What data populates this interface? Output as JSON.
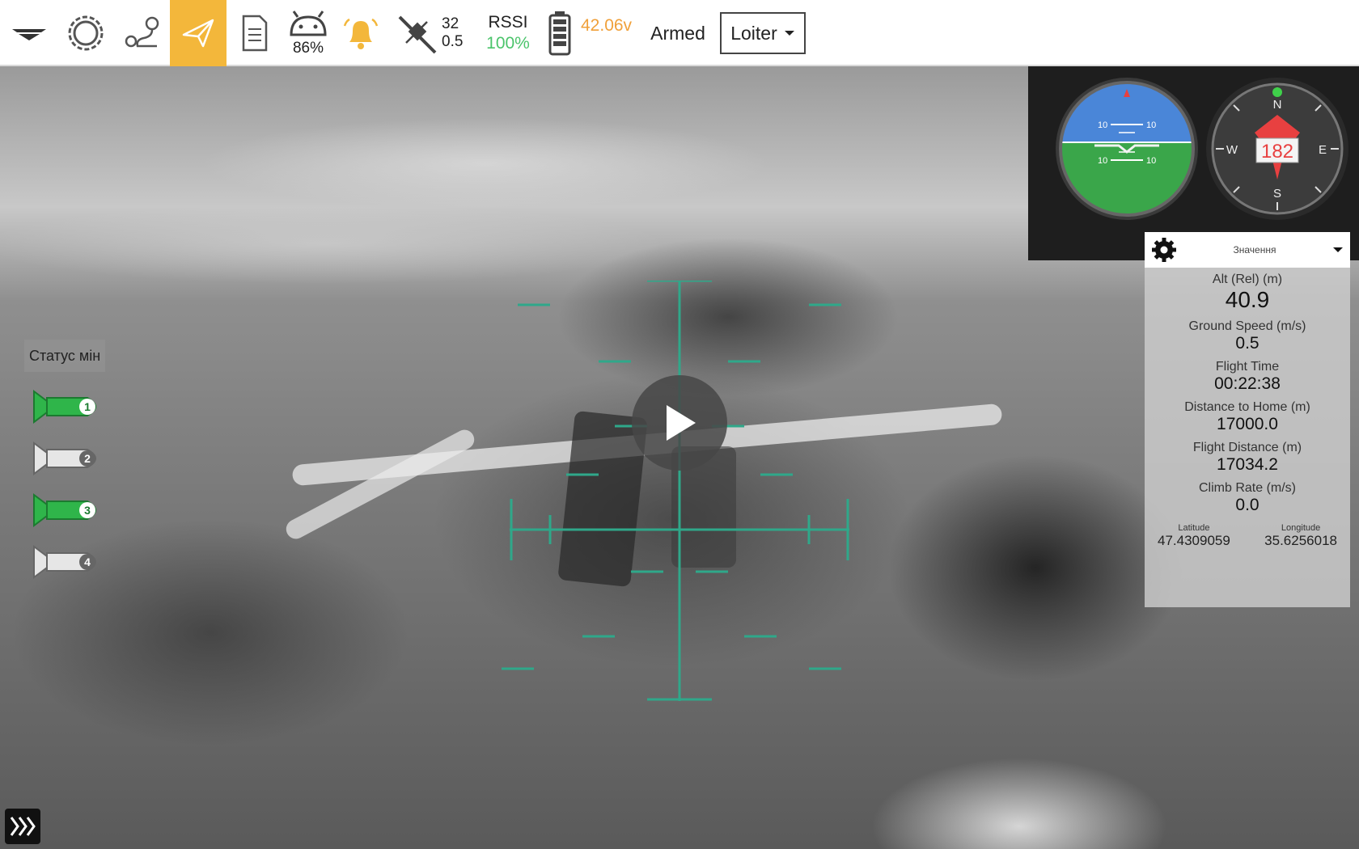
{
  "toolbar": {
    "battery_percent": "86%",
    "satellites_count": "32",
    "hdop": "0.5",
    "rssi_label": "RSSI",
    "rssi_value": "100%",
    "voltage": "42.06v",
    "arm_status": "Armed",
    "flight_mode": "Loiter",
    "colors": {
      "active_tab": "#f3b73b",
      "rssi": "#4bc46b",
      "voltage": "#f0a03a"
    },
    "icons": [
      "menu-icon",
      "settings-gear-icon",
      "plan-route-icon",
      "fly-paper-plane-icon",
      "document-log-icon",
      "android-icon",
      "bell-alert-icon",
      "satellite-icon",
      "battery-icon",
      "chevron-down-icon"
    ]
  },
  "instruments": {
    "attitude_ticks": [
      "10",
      "10",
      "10",
      "10"
    ],
    "compass_heading": "182",
    "compass_labels": {
      "n": "N",
      "e": "E",
      "s": "S",
      "w": "W"
    }
  },
  "mines": {
    "label": "Статус мін",
    "items": [
      {
        "number": "1",
        "armed": true
      },
      {
        "number": "2",
        "armed": false
      },
      {
        "number": "3",
        "armed": true
      },
      {
        "number": "4",
        "armed": false
      }
    ]
  },
  "values_panel": {
    "title": "Значення",
    "alt_label": "Alt (Rel) (m)",
    "alt_value": "40.9",
    "ground_speed_label": "Ground Speed (m/s)",
    "ground_speed_value": "0.5",
    "flight_time_label": "Flight Time",
    "flight_time_value": "00:22:38",
    "distance_home_label": "Distance to Home (m)",
    "distance_home_value": "17000.0",
    "flight_distance_label": "Flight Distance (m)",
    "flight_distance_value": "17034.2",
    "climb_rate_label": "Climb Rate (m/s)",
    "climb_rate_value": "0.0",
    "latitude_label": "Latitude",
    "latitude_value": "47.4309059",
    "longitude_label": "Longitude",
    "longitude_value": "35.6256018"
  },
  "video": {
    "play_icon": "play-icon",
    "expand_icon": "expand-chevrons-icon"
  }
}
